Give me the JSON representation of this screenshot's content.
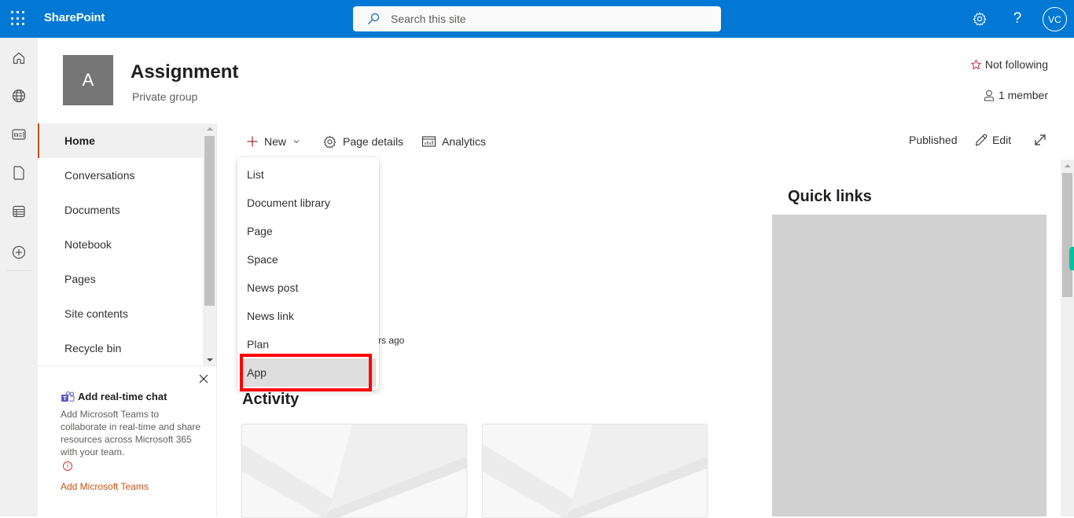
{
  "suitebar": {
    "app_name": "SharePoint",
    "search_placeholder": "Search this site",
    "help_label": "?",
    "avatar_initials": "VC",
    "icons": [
      "waffle-icon",
      "search-icon",
      "settings-icon",
      "help-icon"
    ],
    "background_color": "#0078d4"
  },
  "appbar": {
    "items": [
      {
        "name": "home",
        "icon": "home-icon"
      },
      {
        "name": "sites",
        "icon": "globe-icon"
      },
      {
        "name": "news",
        "icon": "news-icon"
      },
      {
        "name": "files",
        "icon": "document-icon"
      },
      {
        "name": "lists",
        "icon": "lists-icon"
      },
      {
        "name": "create",
        "icon": "add-circle-icon"
      }
    ]
  },
  "site": {
    "logo_letter": "A",
    "title": "Assignment",
    "subtitle": "Private group",
    "follow_label": "Not following",
    "members_label": "1 member"
  },
  "leftnav": {
    "items": [
      {
        "label": "Home",
        "active": true
      },
      {
        "label": "Conversations",
        "active": false
      },
      {
        "label": "Documents",
        "active": false
      },
      {
        "label": "Notebook",
        "active": false
      },
      {
        "label": "Pages",
        "active": false
      },
      {
        "label": "Site contents",
        "active": false
      },
      {
        "label": "Recycle bin",
        "active": false
      }
    ],
    "accent_color": "#ca5010"
  },
  "teams_card": {
    "title": "Add real-time chat",
    "description": "Add Microsoft Teams to collaborate in real-time and share resources across Microsoft 365 with your team.",
    "info_glyph": "i",
    "link_label": "Add Microsoft Teams"
  },
  "commandbar": {
    "new_label": "New",
    "page_details_label": "Page details",
    "analytics_label": "Analytics",
    "status_label": "Published",
    "edit_label": "Edit"
  },
  "new_menu": {
    "items": [
      {
        "label": "List",
        "hovered": false
      },
      {
        "label": "Document library",
        "hovered": false
      },
      {
        "label": "Page",
        "hovered": false
      },
      {
        "label": "Space",
        "hovered": false
      },
      {
        "label": "News post",
        "hovered": false
      },
      {
        "label": "News link",
        "hovered": false
      },
      {
        "label": "Plan",
        "hovered": false
      },
      {
        "label": "App",
        "hovered": true
      }
    ],
    "highlight_color": "#ff0000"
  },
  "main": {
    "partial_text": "rs ago",
    "activity_title": "Activity",
    "quick_links_title": "Quick links"
  }
}
